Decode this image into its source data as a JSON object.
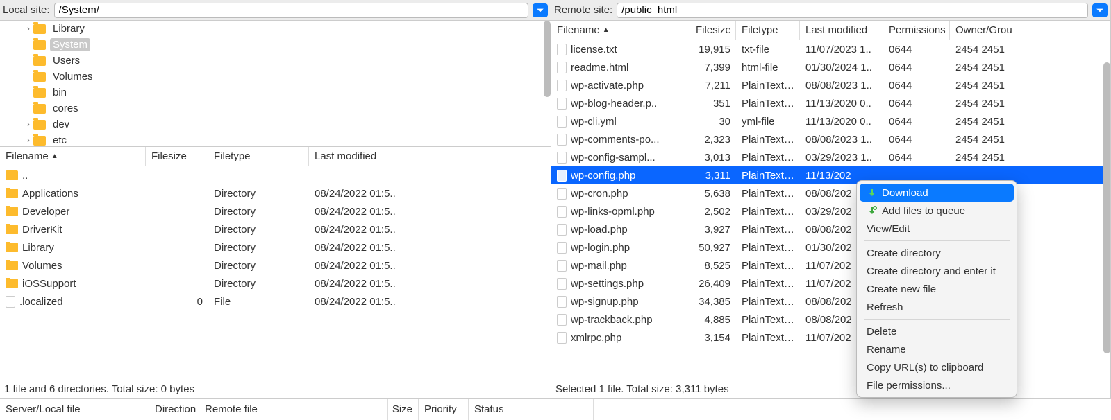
{
  "local": {
    "label": "Local site:",
    "path": "/System/",
    "tree": [
      {
        "name": "Library",
        "indent": 2,
        "arrow": ">",
        "selected": false
      },
      {
        "name": "System",
        "indent": 2,
        "arrow": "",
        "selected": true
      },
      {
        "name": "Users",
        "indent": 2,
        "arrow": "",
        "selected": false
      },
      {
        "name": "Volumes",
        "indent": 2,
        "arrow": "",
        "selected": false
      },
      {
        "name": "bin",
        "indent": 2,
        "arrow": "",
        "selected": false
      },
      {
        "name": "cores",
        "indent": 2,
        "arrow": "",
        "selected": false
      },
      {
        "name": "dev",
        "indent": 2,
        "arrow": ">",
        "selected": false
      },
      {
        "name": "etc",
        "indent": 2,
        "arrow": ">",
        "selected": false
      }
    ],
    "headers": {
      "name": "Filename",
      "size": "Filesize",
      "type": "Filetype",
      "mod": "Last modified"
    },
    "files": [
      {
        "name": "..",
        "icon": "fold",
        "size": "",
        "type": "",
        "mod": ""
      },
      {
        "name": "Applications",
        "icon": "fold",
        "size": "",
        "type": "Directory",
        "mod": "08/24/2022 01:5.."
      },
      {
        "name": "Developer",
        "icon": "fold",
        "size": "",
        "type": "Directory",
        "mod": "08/24/2022 01:5.."
      },
      {
        "name": "DriverKit",
        "icon": "fold",
        "size": "",
        "type": "Directory",
        "mod": "08/24/2022 01:5.."
      },
      {
        "name": "Library",
        "icon": "fold",
        "size": "",
        "type": "Directory",
        "mod": "08/24/2022 01:5.."
      },
      {
        "name": "Volumes",
        "icon": "fold",
        "size": "",
        "type": "Directory",
        "mod": "08/24/2022 01:5.."
      },
      {
        "name": "iOSSupport",
        "icon": "fold",
        "size": "",
        "type": "Directory",
        "mod": "08/24/2022 01:5.."
      },
      {
        "name": ".localized",
        "icon": "file",
        "size": "0",
        "type": "File",
        "mod": "08/24/2022 01:5.."
      }
    ],
    "status": "1 file and 6 directories. Total size: 0 bytes"
  },
  "remote": {
    "label": "Remote site:",
    "path": "/public_html",
    "headers": {
      "name": "Filename",
      "size": "Filesize",
      "type": "Filetype",
      "mod": "Last modified",
      "perm": "Permissions",
      "own": "Owner/Group"
    },
    "files": [
      {
        "name": "license.txt",
        "size": "19,915",
        "type": "txt-file",
        "mod": "11/07/2023 1..",
        "perm": "0644",
        "own": "2454 2451",
        "sel": false
      },
      {
        "name": "readme.html",
        "size": "7,399",
        "type": "html-file",
        "mod": "01/30/2024 1..",
        "perm": "0644",
        "own": "2454 2451",
        "sel": false
      },
      {
        "name": "wp-activate.php",
        "size": "7,211",
        "type": "PlainTextT..",
        "mod": "08/08/2023 1..",
        "perm": "0644",
        "own": "2454 2451",
        "sel": false
      },
      {
        "name": "wp-blog-header.p..",
        "size": "351",
        "type": "PlainTextT..",
        "mod": "11/13/2020 0..",
        "perm": "0644",
        "own": "2454 2451",
        "sel": false
      },
      {
        "name": "wp-cli.yml",
        "size": "30",
        "type": "yml-file",
        "mod": "11/13/2020 0..",
        "perm": "0644",
        "own": "2454 2451",
        "sel": false
      },
      {
        "name": "wp-comments-po...",
        "size": "2,323",
        "type": "PlainTextT..",
        "mod": "08/08/2023 1..",
        "perm": "0644",
        "own": "2454 2451",
        "sel": false
      },
      {
        "name": "wp-config-sampl...",
        "size": "3,013",
        "type": "PlainTextT..",
        "mod": "03/29/2023 1..",
        "perm": "0644",
        "own": "2454 2451",
        "sel": false
      },
      {
        "name": "wp-config.php",
        "size": "3,311",
        "type": "PlainTextT..",
        "mod": "11/13/202",
        "perm": "",
        "own": "",
        "sel": true
      },
      {
        "name": "wp-cron.php",
        "size": "5,638",
        "type": "PlainTextT..",
        "mod": "08/08/202",
        "perm": "",
        "own": "",
        "sel": false
      },
      {
        "name": "wp-links-opml.php",
        "size": "2,502",
        "type": "PlainTextT..",
        "mod": "03/29/202",
        "perm": "",
        "own": "",
        "sel": false
      },
      {
        "name": "wp-load.php",
        "size": "3,927",
        "type": "PlainTextT..",
        "mod": "08/08/202",
        "perm": "",
        "own": "",
        "sel": false
      },
      {
        "name": "wp-login.php",
        "size": "50,927",
        "type": "PlainTextT..",
        "mod": "01/30/202",
        "perm": "",
        "own": "",
        "sel": false
      },
      {
        "name": "wp-mail.php",
        "size": "8,525",
        "type": "PlainTextT..",
        "mod": "11/07/202",
        "perm": "",
        "own": "",
        "sel": false
      },
      {
        "name": "wp-settings.php",
        "size": "26,409",
        "type": "PlainTextT..",
        "mod": "11/07/202",
        "perm": "",
        "own": "",
        "sel": false
      },
      {
        "name": "wp-signup.php",
        "size": "34,385",
        "type": "PlainTextT..",
        "mod": "08/08/202",
        "perm": "",
        "own": "",
        "sel": false
      },
      {
        "name": "wp-trackback.php",
        "size": "4,885",
        "type": "PlainTextT..",
        "mod": "08/08/202",
        "perm": "",
        "own": "",
        "sel": false
      },
      {
        "name": "xmlrpc.php",
        "size": "3,154",
        "type": "PlainTextT..",
        "mod": "11/07/202",
        "perm": "",
        "own": "",
        "sel": false
      }
    ],
    "status": "Selected 1 file. Total size: 3,311 bytes"
  },
  "queue": {
    "server": "Server/Local file",
    "direction": "Direction",
    "remote": "Remote file",
    "size": "Size",
    "priority": "Priority",
    "status": "Status"
  },
  "context_menu": {
    "download": "Download",
    "add_queue": "Add files to queue",
    "view_edit": "View/Edit",
    "create_dir": "Create directory",
    "create_dir_enter": "Create directory and enter it",
    "create_file": "Create new file",
    "refresh": "Refresh",
    "delete": "Delete",
    "rename": "Rename",
    "copy_url": "Copy URL(s) to clipboard",
    "file_perm": "File permissions..."
  }
}
